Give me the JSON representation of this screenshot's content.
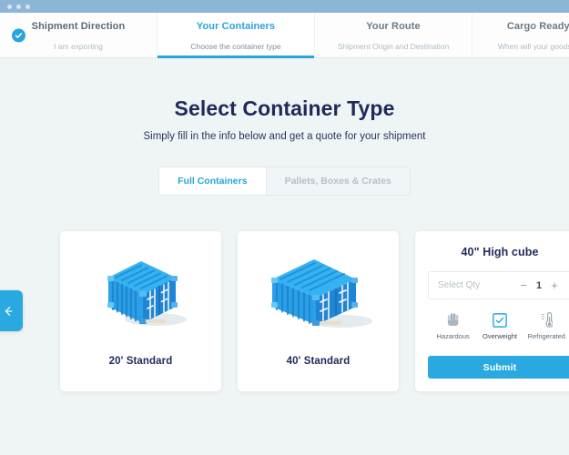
{
  "window": {
    "dots": [
      "dot-1",
      "dot-2",
      "dot-3"
    ]
  },
  "steps": [
    {
      "title": "Shipment Direction",
      "subtitle": "I am exporting",
      "state": "done",
      "badge_icon": "check-circle-icon"
    },
    {
      "title": "Your Containers",
      "subtitle": "Choose the container type",
      "state": "active"
    },
    {
      "title": "Your Route",
      "subtitle": "Shipment Origin and Destination",
      "state": "upcoming"
    },
    {
      "title": "Cargo Ready Date",
      "subtitle": "When will your goods be ready",
      "state": "upcoming"
    }
  ],
  "back_button": {
    "icon": "arrow-left-icon",
    "label": "Back"
  },
  "header": {
    "title": "Select Container Type",
    "subtitle": "Simply fill in the info below and get a quote for your shipment"
  },
  "segmented_control": {
    "options": [
      {
        "label": "Full Containers",
        "active": true
      },
      {
        "label": "Pallets, Boxes & Crates",
        "active": false
      }
    ]
  },
  "container_cards": [
    {
      "label": "20' Standard",
      "illustration": "shipping-container-20ft-icon"
    },
    {
      "label": "40' Standard",
      "illustration": "shipping-container-40ft-icon"
    }
  ],
  "detail_card": {
    "title": "40\" High cube",
    "quantity": {
      "placeholder": "Select Qty",
      "value": "1",
      "decrement_label": "−",
      "increment_label": "+"
    },
    "options": [
      {
        "label": "Hazardous",
        "icon": "hazardous-glove-icon",
        "selected": false
      },
      {
        "label": "Overweight",
        "icon": "overweight-check-icon",
        "selected": true
      },
      {
        "label": "Refrigerated",
        "icon": "thermometer-icon",
        "selected": false
      }
    ],
    "submit_label": "Submit"
  },
  "colors": {
    "accent": "#2aa9e0",
    "accent_text": "#29a3dc",
    "page_bg": "#eff4f4",
    "title_bar": "#8cb6d6",
    "heading": "#1f2a5a",
    "muted": "#aebbc4",
    "container_blue": "#29a8ef",
    "container_blue_dark": "#1f7fd1",
    "container_blue_light": "#5ec6f7"
  }
}
